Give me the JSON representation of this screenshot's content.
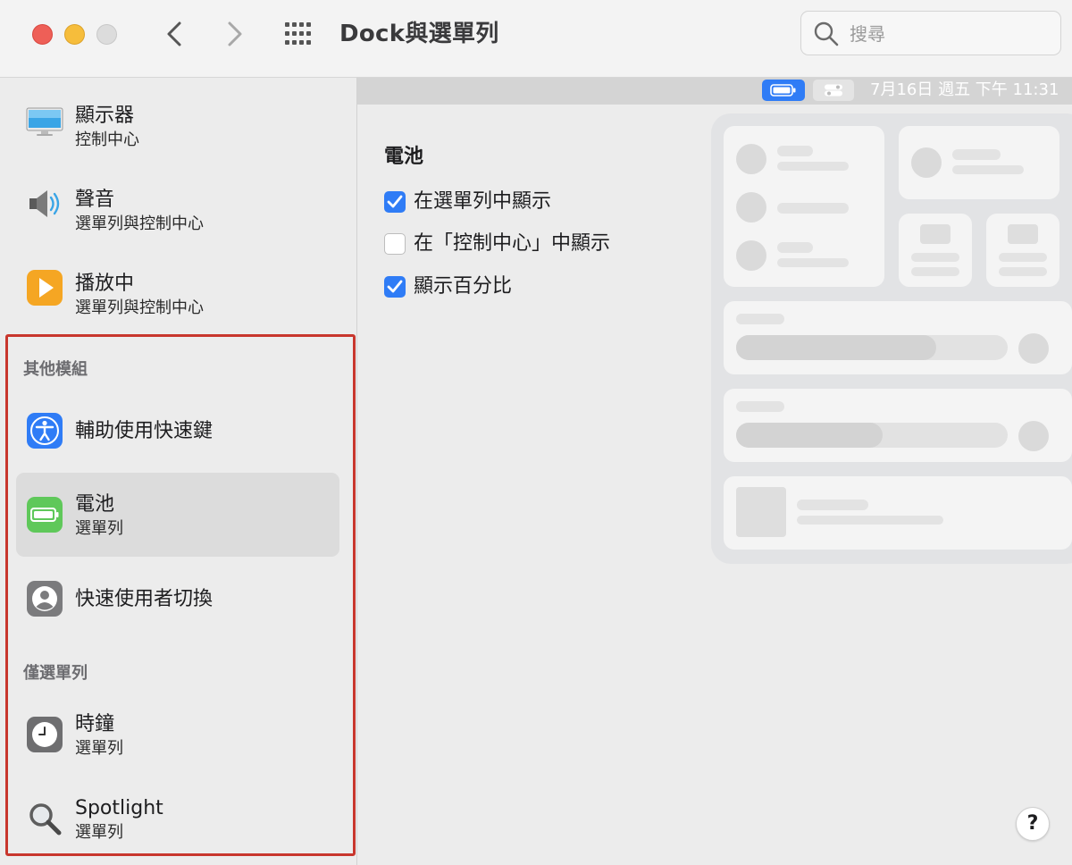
{
  "window": {
    "title": "Dock與選單列"
  },
  "search": {
    "placeholder": "搜尋",
    "value": ""
  },
  "sidebar": {
    "items_top": [
      {
        "title": "顯示器",
        "subtitle": "控制中心",
        "icon": "display-icon"
      },
      {
        "title": "聲音",
        "subtitle": "選單列與控制中心",
        "icon": "speaker-icon"
      },
      {
        "title": "播放中",
        "subtitle": "選單列與控制中心",
        "icon": "play-icon"
      }
    ],
    "section_other": {
      "header": "其他模組",
      "items": [
        {
          "title": "輔助使用快速鍵",
          "subtitle": "",
          "icon": "accessibility-icon"
        },
        {
          "title": "電池",
          "subtitle": "選單列",
          "icon": "battery-icon",
          "selected": true
        },
        {
          "title": "快速使用者切換",
          "subtitle": "",
          "icon": "user-switch-icon"
        }
      ]
    },
    "section_menubar_only": {
      "header": "僅選單列",
      "items": [
        {
          "title": "時鐘",
          "subtitle": "選單列",
          "icon": "clock-icon"
        },
        {
          "title": "Spotlight",
          "subtitle": "選單列",
          "icon": "spotlight-icon"
        }
      ]
    }
  },
  "menubar_preview": {
    "clock": "7月16日 週五 下午 11:31"
  },
  "main": {
    "section_title": "電池",
    "options": [
      {
        "label": "在選單列中顯示",
        "checked": true
      },
      {
        "label": "在「控制中心」中顯示",
        "checked": false
      },
      {
        "label": "顯示百分比",
        "checked": true
      }
    ],
    "help_label": "?"
  },
  "colors": {
    "accent": "#2f7cf6",
    "highlight_border": "#c8362d",
    "selected_row": "#dcdcdc"
  }
}
